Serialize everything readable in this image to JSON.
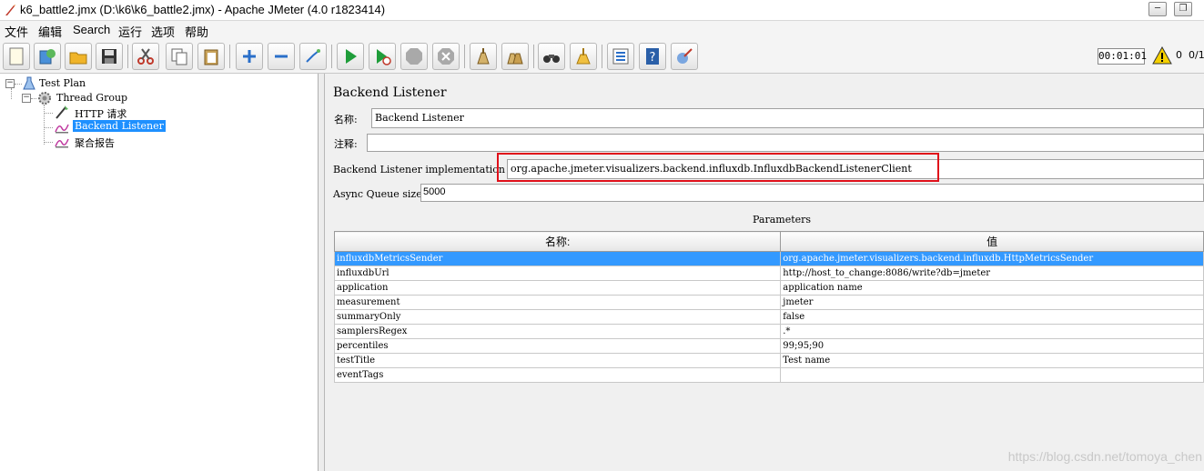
{
  "window": {
    "title": "k6_battle2.jmx (D:\\k6\\k6_battle2.jmx) - Apache JMeter (4.0 r1823414)",
    "minimize_label": "─",
    "restore_label": "❐"
  },
  "menu": [
    "文件",
    "编辑",
    "Search",
    "运行",
    "选项",
    "帮助"
  ],
  "toolbar": {
    "icons": [
      "new-icon",
      "templates-icon",
      "open-icon",
      "save-icon",
      "cut-icon",
      "copy-icon",
      "paste-icon",
      "expand-icon",
      "collapse-icon",
      "toggle-icon",
      "start-icon",
      "start-no-pause-icon",
      "stop-icon",
      "shutdown-icon",
      "clear-icon",
      "clear-all-icon",
      "search-icon",
      "reset-search-icon",
      "function-helper-icon",
      "help-icon",
      "remote-icon"
    ],
    "timer": "00:01:01",
    "warning_count": "0",
    "threads": "0/1"
  },
  "tree": {
    "nodes": [
      {
        "label": "Test Plan",
        "icon": "test-plan-icon"
      },
      {
        "label": "Thread Group",
        "icon": "thread-group-icon"
      },
      {
        "label": "HTTP 请求",
        "icon": "http-sampler-icon"
      },
      {
        "label": "Backend Listener",
        "icon": "listener-icon"
      },
      {
        "label": "聚合报告",
        "icon": "listener-icon"
      }
    ],
    "expander_symbol": "−"
  },
  "panel": {
    "title": "Backend Listener",
    "name_label": "名称:",
    "name_value": "Backend Listener",
    "comment_label": "注释:",
    "comment_value": "",
    "impl_label": "Backend Listener implementation",
    "impl_value": "org.apache.jmeter.visualizers.backend.influxdb.InfluxdbBackendListenerClient",
    "queue_label": "Async Queue size",
    "queue_value": "5000",
    "params_title": "Parameters",
    "params_headers": [
      "名称:",
      "值"
    ],
    "params_rows": [
      [
        "influxdbMetricsSender",
        "org.apache.jmeter.visualizers.backend.influxdb.HttpMetricsSender"
      ],
      [
        "influxdbUrl",
        "http://host_to_change:8086/write?db=jmeter"
      ],
      [
        "application",
        "application name"
      ],
      [
        "measurement",
        "jmeter"
      ],
      [
        "summaryOnly",
        "false"
      ],
      [
        "samplersRegex",
        ".*"
      ],
      [
        "percentiles",
        "99;95;90"
      ],
      [
        "testTitle",
        "Test name"
      ],
      [
        "eventTags",
        ""
      ]
    ]
  },
  "watermark": "https://blog.csdn.net/tomoya_chen",
  "colors": {
    "selection": "#1e90ff",
    "highlight_box": "#e0101a"
  }
}
